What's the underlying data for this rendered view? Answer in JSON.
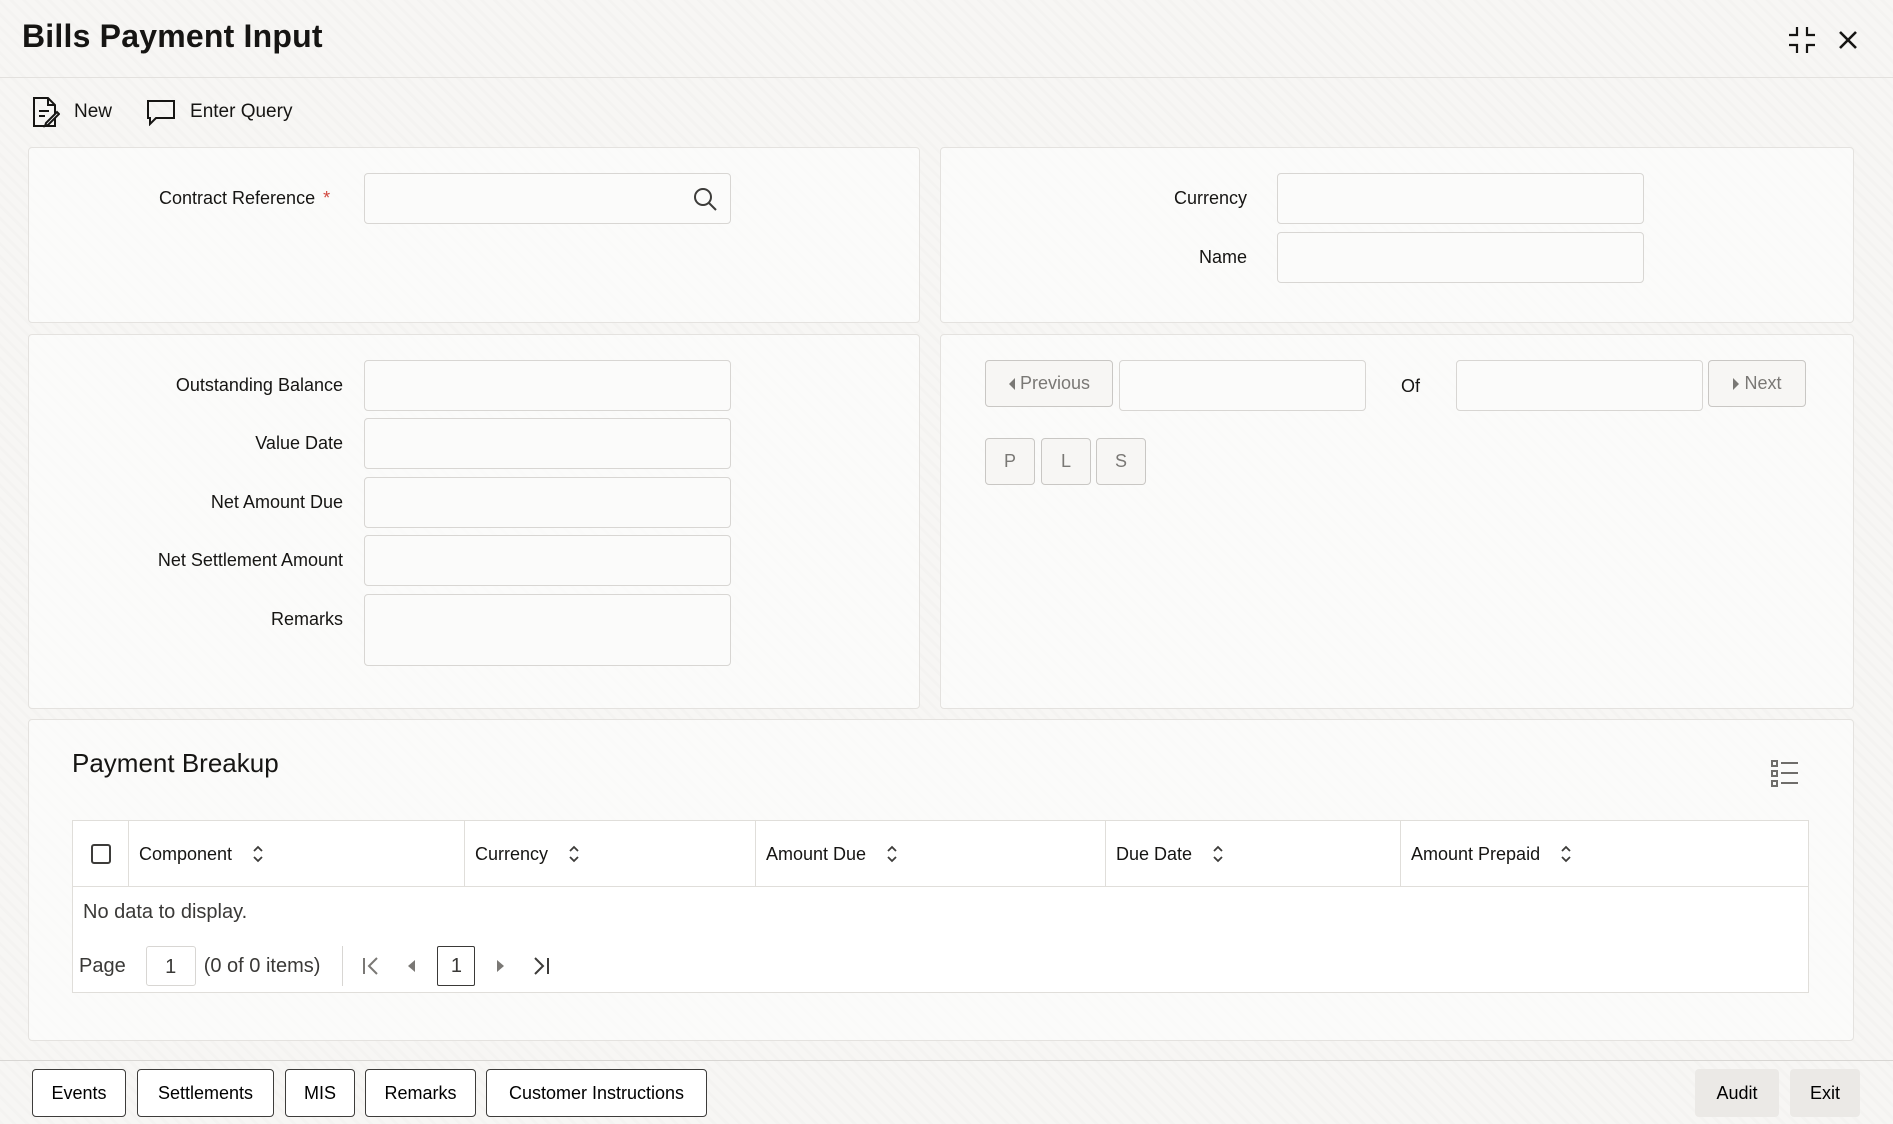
{
  "header": {
    "title": "Bills Payment Input"
  },
  "window_controls": {
    "minimize_icon": "collapse-icon",
    "close_icon": "close-icon"
  },
  "toolbar": {
    "new_label": "New",
    "enter_query_label": "Enter Query"
  },
  "contract_panel": {
    "contract_reference_label": "Contract Reference",
    "required_mark": "*",
    "contract_reference_value": ""
  },
  "customer_panel": {
    "currency_label": "Currency",
    "currency_value": "",
    "name_label": "Name",
    "name_value": ""
  },
  "balance_panel": {
    "outstanding_balance_label": "Outstanding Balance",
    "value_date_label": "Value Date",
    "net_amount_due_label": "Net Amount Due",
    "net_settlement_amount_label": "Net Settlement Amount",
    "remarks_label": "Remarks"
  },
  "navigator": {
    "previous_label": "Previous",
    "of_label": "Of",
    "next_label": "Next",
    "p_label": "P",
    "l_label": "L",
    "s_label": "S"
  },
  "payment_breakup": {
    "title": "Payment Breakup",
    "columns": [
      "Component",
      "Currency",
      "Amount Due",
      "Due Date",
      "Amount Prepaid"
    ],
    "no_data": "No data to display.",
    "page_label": "Page",
    "page_value": "1",
    "items_summary": "(0 of 0 items)",
    "current_page": "1"
  },
  "footer": {
    "events": "Events",
    "settlements": "Settlements",
    "mis": "MIS",
    "remarks": "Remarks",
    "customer_instructions": "Customer Instructions",
    "audit": "Audit",
    "exit": "Exit"
  },
  "colors": {
    "required": "#d0453c",
    "text": "#161513",
    "border": "#d8d6d3"
  }
}
